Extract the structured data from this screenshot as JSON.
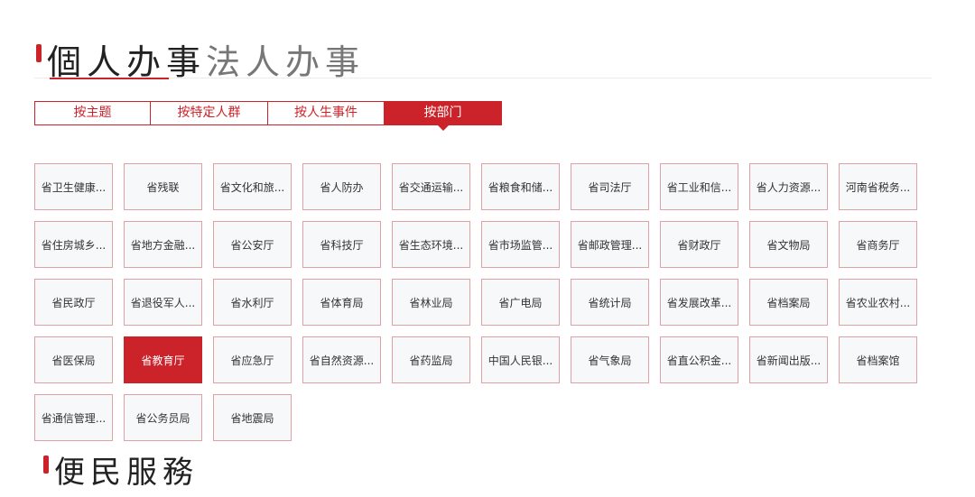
{
  "section_tabs": {
    "personal": "個人办事",
    "corporate": "法人办事"
  },
  "filter_tabs": [
    {
      "label": "按主题"
    },
    {
      "label": "按特定人群"
    },
    {
      "label": "按人生事件"
    },
    {
      "label": "按部门"
    }
  ],
  "active_filter": "按部门",
  "departments": [
    "省卫生健康...",
    "省残联",
    "省文化和旅...",
    "省人防办",
    "省交通运输...",
    "省粮食和储...",
    "省司法厅",
    "省工业和信...",
    "省人力资源...",
    "河南省税务...",
    "省住房城乡...",
    "省地方金融...",
    "省公安厅",
    "省科技厅",
    "省生态环境...",
    "省市场监管...",
    "省邮政管理...",
    "省财政厅",
    "省文物局",
    "省商务厅",
    "省民政厅",
    "省退役军人...",
    "省水利厅",
    "省体育局",
    "省林业局",
    "省广电局",
    "省统计局",
    "省发展改革...",
    "省档案局",
    "省农业农村...",
    "省医保局",
    "省教育厅",
    "省应急厅",
    "省自然资源...",
    "省药监局",
    "中国人民银...",
    "省气象局",
    "省直公积金...",
    "省新闻出版...",
    "省档案馆",
    "省通信管理...",
    "省公务员局",
    "省地震局"
  ],
  "selected_department": "省教育厅",
  "convenience_heading": "便民服務",
  "colors": {
    "accent": "#cc2229",
    "cell_bg": "#f7f8fa",
    "cell_border": "#e0a0a4"
  }
}
